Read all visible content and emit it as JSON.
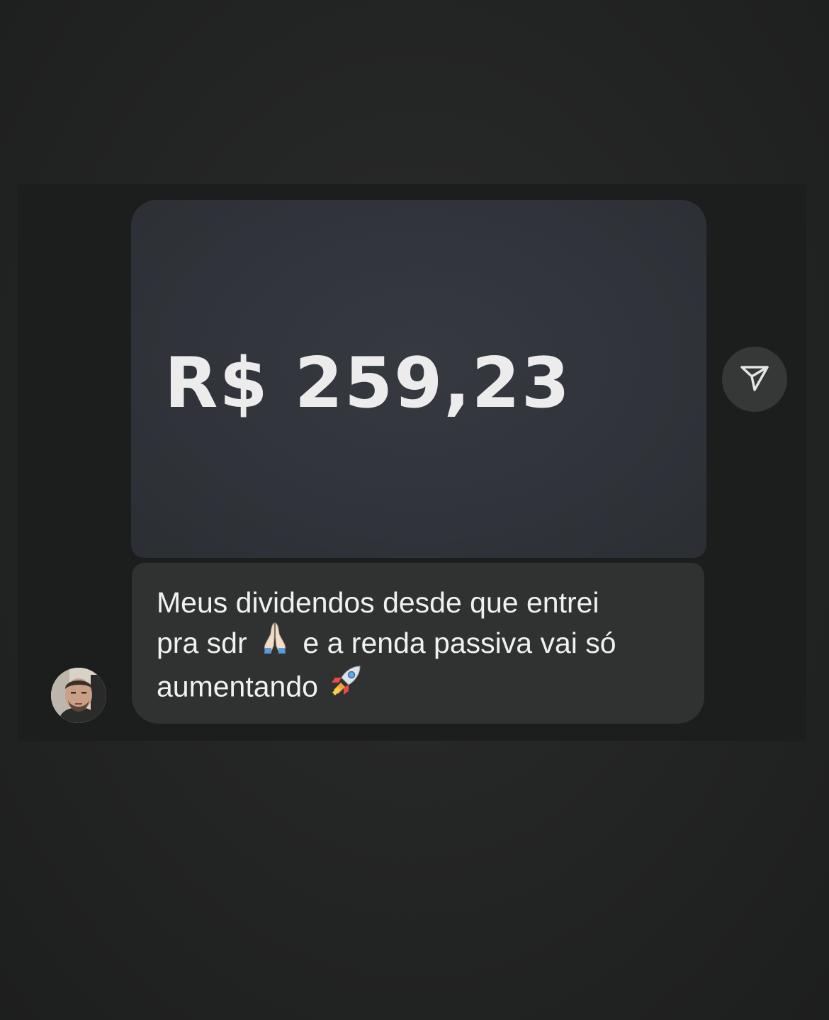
{
  "conversation": {
    "image_message": {
      "amount": "R$ 259,23"
    },
    "text_message": {
      "line1": "Meus dividendos desde que entrei",
      "line2_before_emoji": "pra sdr",
      "line2_after_emoji": "e a renda passiva vai só",
      "line3": "aumentando",
      "emoji_1": "folded-hands",
      "emoji_2": "rocket"
    },
    "share_icon": "paper-plane-icon",
    "avatar_icon": "user-avatar"
  },
  "colors": {
    "page_background": "#232424",
    "image_bubble": "#30343a",
    "text_bubble": "#2f3230",
    "text": "#f1f1f1",
    "share_button_bg": "#363837"
  }
}
